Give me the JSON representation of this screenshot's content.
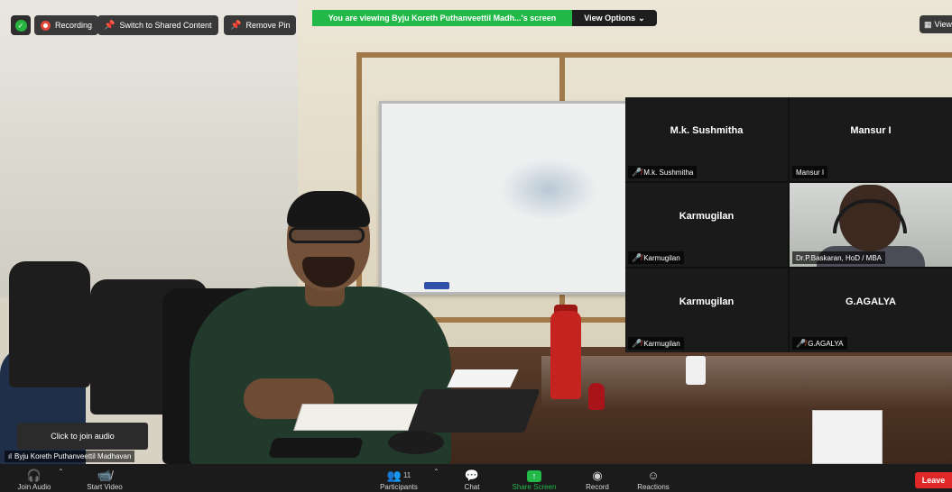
{
  "top_bar": {
    "recording_label": "Recording",
    "switch_label": "Switch to Shared Content",
    "remove_pin_label": "Remove Pin",
    "share_banner": "You are viewing Byju Koreth Puthanveettil Madh...'s screen",
    "view_options_label": "View Options",
    "view_right_label": "View"
  },
  "gallery": {
    "tiles": [
      {
        "display_name": "M.k. Sushmitha",
        "label": "M.k. Sushmitha",
        "muted": true
      },
      {
        "display_name": "Mansur I",
        "label": "Mansur I",
        "muted": false
      },
      {
        "display_name": "Karmugilan",
        "label": "Karmugilan",
        "muted": true
      },
      {
        "display_name": "",
        "label": "Dr.P.Baskaran, HoD / MBA",
        "muted": false,
        "video": true
      },
      {
        "display_name": "Karmugilan",
        "label": "Karmugilan",
        "muted": true
      },
      {
        "display_name": "G.AGALYA",
        "label": "G.AGALYA",
        "muted": true
      }
    ]
  },
  "audio_popup": {
    "text": "Click to join audio"
  },
  "active_speaker": {
    "name": "Byju Koreth Puthanveettil Madhavan"
  },
  "toolbar": {
    "join_audio": "Join Audio",
    "start_video": "Start Video",
    "participants": "Participants",
    "participants_count": "11",
    "chat": "Chat",
    "share_screen": "Share Screen",
    "record": "Record",
    "reactions": "Reactions",
    "leave": "Leave"
  },
  "icons": {
    "security": "shield-icon",
    "recording": "record-dot-icon",
    "pin": "pin-icon",
    "headphones": "headphones-icon",
    "video_off": "video-off-icon",
    "participants": "people-icon",
    "chat": "chat-bubble-icon",
    "share": "share-arrow-icon",
    "record": "record-icon",
    "reactions": "smiley-icon",
    "mic_muted": "mic-muted-icon",
    "signal": "signal-bars-icon"
  },
  "colors": {
    "share_green": "#23b949",
    "leave_red": "#e02828",
    "recording_red": "#e3473b",
    "toolbar_bg": "#1b1b1b"
  }
}
